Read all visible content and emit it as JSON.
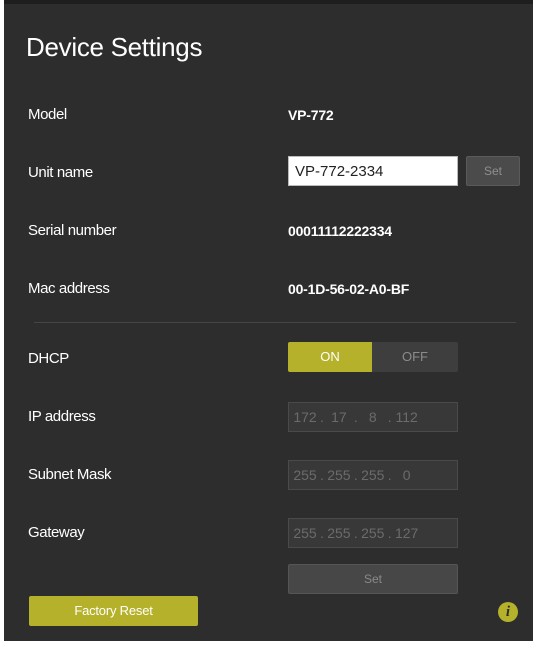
{
  "title": "Device Settings",
  "model": {
    "label": "Model",
    "value": "VP-772"
  },
  "unit_name": {
    "label": "Unit name",
    "value": "VP-772-2334",
    "set_label": "Set"
  },
  "serial": {
    "label": "Serial number",
    "value": "00011112222334"
  },
  "mac": {
    "label": "Mac address",
    "value": "00-1D-56-02-A0-BF"
  },
  "dhcp": {
    "label": "DHCP",
    "on": "ON",
    "off": "OFF",
    "state": "ON"
  },
  "ip": {
    "label": "IP address",
    "octets": [
      "172",
      "17",
      "8",
      "112"
    ]
  },
  "subnet": {
    "label": "Subnet Mask",
    "octets": [
      "255",
      "255",
      "255",
      "0"
    ]
  },
  "gateway": {
    "label": "Gateway",
    "octets": [
      "255",
      "255",
      "255",
      "127"
    ]
  },
  "network_set_label": "Set",
  "factory_reset_label": "Factory Reset",
  "info_glyph": "i",
  "colors": {
    "accent": "#b5b12b",
    "panel": "#2d2d2d"
  }
}
